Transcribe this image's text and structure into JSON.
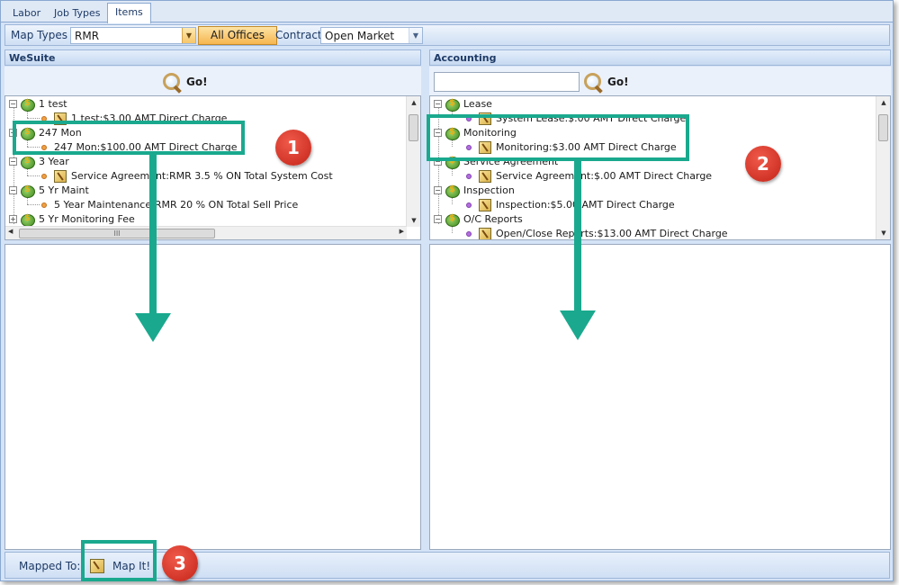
{
  "tabs": [
    {
      "label": "Labor"
    },
    {
      "label": "Job Types"
    },
    {
      "label": "Items"
    }
  ],
  "toolbar": {
    "map_types_label": "Map Types",
    "map_types_value": "RMR",
    "offices_button": "All Offices",
    "contract_label": "Contract",
    "contract_value": "Open Market"
  },
  "left_panel": {
    "title": "WeSuite",
    "go_label": "Go!",
    "tree": [
      {
        "label": "1 test",
        "child": "1 test:$3.00 AMT Direct Charge"
      },
      {
        "label": "247 Mon",
        "child": "247 Mon:$100.00 AMT Direct Charge"
      },
      {
        "label": "3 Year",
        "child": "Service Agreement:RMR 3.5 % ON Total System Cost"
      },
      {
        "label": "5 Yr Maint",
        "child": "5 Year Maintenance:RMR 20 % ON Total Sell Price"
      },
      {
        "label": "5 Yr Monitoring Fee",
        "child": ""
      }
    ]
  },
  "right_panel": {
    "title": "Accounting",
    "go_label": "Go!",
    "search_value": "",
    "tree": [
      {
        "label": "Lease",
        "child": "System Lease:$.00 AMT Direct Charge"
      },
      {
        "label": "Monitoring",
        "child": "Monitoring:$3.00 AMT Direct Charge"
      },
      {
        "label": "Service Agreement",
        "child": "Service Agreement:$.00 AMT Direct Charge"
      },
      {
        "label": "Inspection",
        "child": "Inspection:$5.00 AMT Direct Charge"
      },
      {
        "label": "O/C Reports",
        "child": "Open/Close Reports:$13.00 AMT Direct Charge"
      }
    ]
  },
  "status": {
    "mapped_to_label": "Mapped To:",
    "map_it_label": "Map It!"
  },
  "annotations": {
    "badge1": "1",
    "badge2": "2",
    "badge3": "3",
    "color": "#1aa98e",
    "badge_color": "#d83a2c"
  },
  "scroll_grip": "III"
}
